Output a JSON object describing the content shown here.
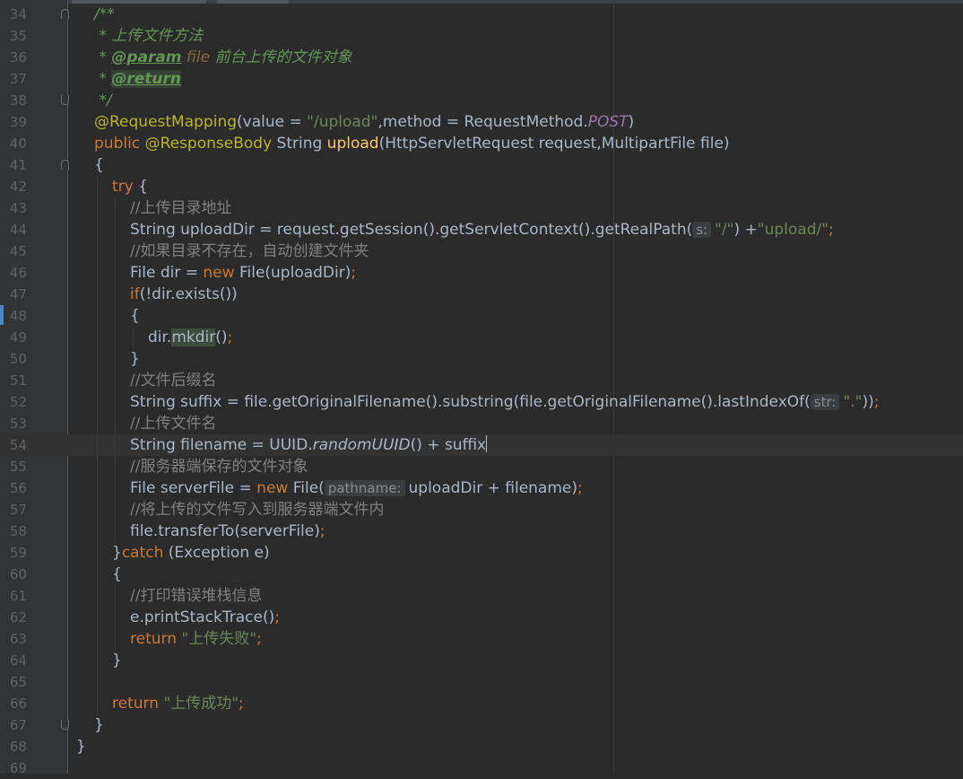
{
  "editor": {
    "colors": {
      "background": "#2b2b2b",
      "gutter": "#313335",
      "keyword": "#cc7832",
      "string": "#6a8759",
      "comment": "#808080",
      "annotation": "#bbb529",
      "javadoc": "#629755"
    },
    "current_line": 54,
    "lines": [
      {
        "num": "34",
        "indent": 1,
        "fold": "start",
        "tokens": [
          {
            "t": "/**",
            "c": "doc"
          }
        ]
      },
      {
        "num": "35",
        "indent": 1,
        "tokens": [
          {
            "t": " * 上传文件方法",
            "c": "doc"
          }
        ]
      },
      {
        "num": "36",
        "indent": 1,
        "tokens": [
          {
            "t": " * ",
            "c": "doc"
          },
          {
            "t": "@param",
            "c": "tag"
          },
          {
            "t": " file",
            "c": "param"
          },
          {
            "t": " 前台上传的文件对象",
            "c": "doc"
          }
        ]
      },
      {
        "num": "37",
        "indent": 1,
        "tokens": [
          {
            "t": " * ",
            "c": "doc"
          },
          {
            "t": "@return",
            "c": "tag hl"
          }
        ]
      },
      {
        "num": "38",
        "indent": 1,
        "fold": "end",
        "tokens": [
          {
            "t": " */",
            "c": "doc"
          }
        ]
      },
      {
        "num": "39",
        "indent": 1,
        "tokens": [
          {
            "t": "@RequestMapping",
            "c": "ann"
          },
          {
            "t": "(value = ",
            "c": ""
          },
          {
            "t": "\"/upload\"",
            "c": "str"
          },
          {
            "t": ",method = RequestMethod.",
            "c": ""
          },
          {
            "t": "POST",
            "c": "static"
          },
          {
            "t": ")",
            "c": ""
          }
        ]
      },
      {
        "num": "40",
        "indent": 1,
        "tokens": [
          {
            "t": "public ",
            "c": "kw"
          },
          {
            "t": "@ResponseBody",
            "c": "ann"
          },
          {
            "t": " String ",
            "c": ""
          },
          {
            "t": "upload",
            "c": "fn"
          },
          {
            "t": "(HttpServletRequest request,MultipartFile file)",
            "c": ""
          }
        ]
      },
      {
        "num": "41",
        "indent": 1,
        "fold": "start",
        "tokens": [
          {
            "t": "{",
            "c": ""
          }
        ]
      },
      {
        "num": "42",
        "indent": 2,
        "tokens": [
          {
            "t": "try ",
            "c": "kw"
          },
          {
            "t": "{",
            "c": ""
          }
        ]
      },
      {
        "num": "43",
        "indent": 3,
        "tokens": [
          {
            "t": "//上传目录地址",
            "c": "cmt"
          }
        ]
      },
      {
        "num": "44",
        "indent": 3,
        "tokens": [
          {
            "t": "String uploadDir = request.getSession().getServletContext().getRealPath(",
            "c": ""
          },
          {
            "t": "s:",
            "c": "hint"
          },
          {
            "t": "\"/\"",
            "c": "str"
          },
          {
            "t": ") +",
            "c": ""
          },
          {
            "t": "\"upload/\"",
            "c": "str"
          },
          {
            "t": ";",
            "c": "kw"
          }
        ]
      },
      {
        "num": "45",
        "indent": 3,
        "tokens": [
          {
            "t": "//如果目录不存在，自动创建文件夹",
            "c": "cmt"
          }
        ]
      },
      {
        "num": "46",
        "indent": 3,
        "tokens": [
          {
            "t": "File dir = ",
            "c": ""
          },
          {
            "t": "new ",
            "c": "kw"
          },
          {
            "t": "File(uploadDir)",
            "c": ""
          },
          {
            "t": ";",
            "c": "kw"
          }
        ]
      },
      {
        "num": "47",
        "indent": 3,
        "tokens": [
          {
            "t": "if",
            "c": "kw"
          },
          {
            "t": "(!dir.exists())",
            "c": ""
          }
        ]
      },
      {
        "num": "48",
        "indent": 3,
        "tokens": [
          {
            "t": "{",
            "c": ""
          }
        ]
      },
      {
        "num": "49",
        "indent": 4,
        "tokens": [
          {
            "t": "dir.",
            "c": ""
          },
          {
            "t": "mkdir",
            "c": "hlw"
          },
          {
            "t": "()",
            "c": ""
          },
          {
            "t": ";",
            "c": "kw"
          }
        ]
      },
      {
        "num": "50",
        "indent": 3,
        "tokens": [
          {
            "t": "}",
            "c": ""
          }
        ]
      },
      {
        "num": "51",
        "indent": 3,
        "tokens": [
          {
            "t": "//文件后缀名",
            "c": "cmt"
          }
        ]
      },
      {
        "num": "52",
        "indent": 3,
        "tokens": [
          {
            "t": "String suffix = file.getOriginalFilename().substring(file.getOriginalFilename().lastIndexOf(",
            "c": ""
          },
          {
            "t": "str:",
            "c": "hint"
          },
          {
            "t": "\".\"",
            "c": "str"
          },
          {
            "t": "))",
            "c": ""
          },
          {
            "t": ";",
            "c": "kw"
          }
        ]
      },
      {
        "num": "53",
        "indent": 3,
        "tokens": [
          {
            "t": "//上传文件名",
            "c": "cmt"
          }
        ]
      },
      {
        "num": "54",
        "indent": 3,
        "tokens": [
          {
            "t": "String filename = UUID.",
            "c": ""
          },
          {
            "t": "randomUUID",
            "c": "ital"
          },
          {
            "t": "() + suffix",
            "c": ""
          },
          {
            "t": "",
            "c": "caret"
          }
        ]
      },
      {
        "num": "55",
        "indent": 3,
        "tokens": [
          {
            "t": "//服务器端保存的文件对象",
            "c": "cmt"
          }
        ]
      },
      {
        "num": "56",
        "indent": 3,
        "tokens": [
          {
            "t": "File serverFile = ",
            "c": ""
          },
          {
            "t": "new ",
            "c": "kw"
          },
          {
            "t": "File(",
            "c": ""
          },
          {
            "t": "pathname:",
            "c": "hint"
          },
          {
            "t": "uploadDir + filename)",
            "c": ""
          },
          {
            "t": ";",
            "c": "kw"
          }
        ]
      },
      {
        "num": "57",
        "indent": 3,
        "tokens": [
          {
            "t": "//将上传的文件写入到服务器端文件内",
            "c": "cmt"
          }
        ]
      },
      {
        "num": "58",
        "indent": 3,
        "tokens": [
          {
            "t": "file.transferTo(serverFile)",
            "c": ""
          },
          {
            "t": ";",
            "c": "kw"
          }
        ]
      },
      {
        "num": "59",
        "indent": 2,
        "tokens": [
          {
            "t": "}",
            "c": ""
          },
          {
            "t": "catch ",
            "c": "kw"
          },
          {
            "t": "(Exception e)",
            "c": ""
          }
        ]
      },
      {
        "num": "60",
        "indent": 2,
        "tokens": [
          {
            "t": "{",
            "c": ""
          }
        ]
      },
      {
        "num": "61",
        "indent": 3,
        "tokens": [
          {
            "t": "//打印错误堆栈信息",
            "c": "cmt"
          }
        ]
      },
      {
        "num": "62",
        "indent": 3,
        "tokens": [
          {
            "t": "e.printStackTrace()",
            "c": ""
          },
          {
            "t": ";",
            "c": "kw"
          }
        ]
      },
      {
        "num": "63",
        "indent": 3,
        "tokens": [
          {
            "t": "return ",
            "c": "kw"
          },
          {
            "t": "\"上传失败\"",
            "c": "str"
          },
          {
            "t": ";",
            "c": "kw"
          }
        ]
      },
      {
        "num": "64",
        "indent": 2,
        "tokens": [
          {
            "t": "}",
            "c": ""
          }
        ]
      },
      {
        "num": "65",
        "indent": 2,
        "tokens": []
      },
      {
        "num": "66",
        "indent": 2,
        "tokens": [
          {
            "t": "return ",
            "c": "kw"
          },
          {
            "t": "\"上传成功\"",
            "c": "str"
          },
          {
            "t": ";",
            "c": "kw"
          }
        ]
      },
      {
        "num": "67",
        "indent": 1,
        "fold": "end",
        "tokens": [
          {
            "t": "}",
            "c": ""
          }
        ]
      },
      {
        "num": "68",
        "indent": 0,
        "tokens": [
          {
            "t": "}",
            "c": ""
          }
        ]
      },
      {
        "num": "69",
        "indent": 0,
        "tokens": []
      }
    ]
  }
}
